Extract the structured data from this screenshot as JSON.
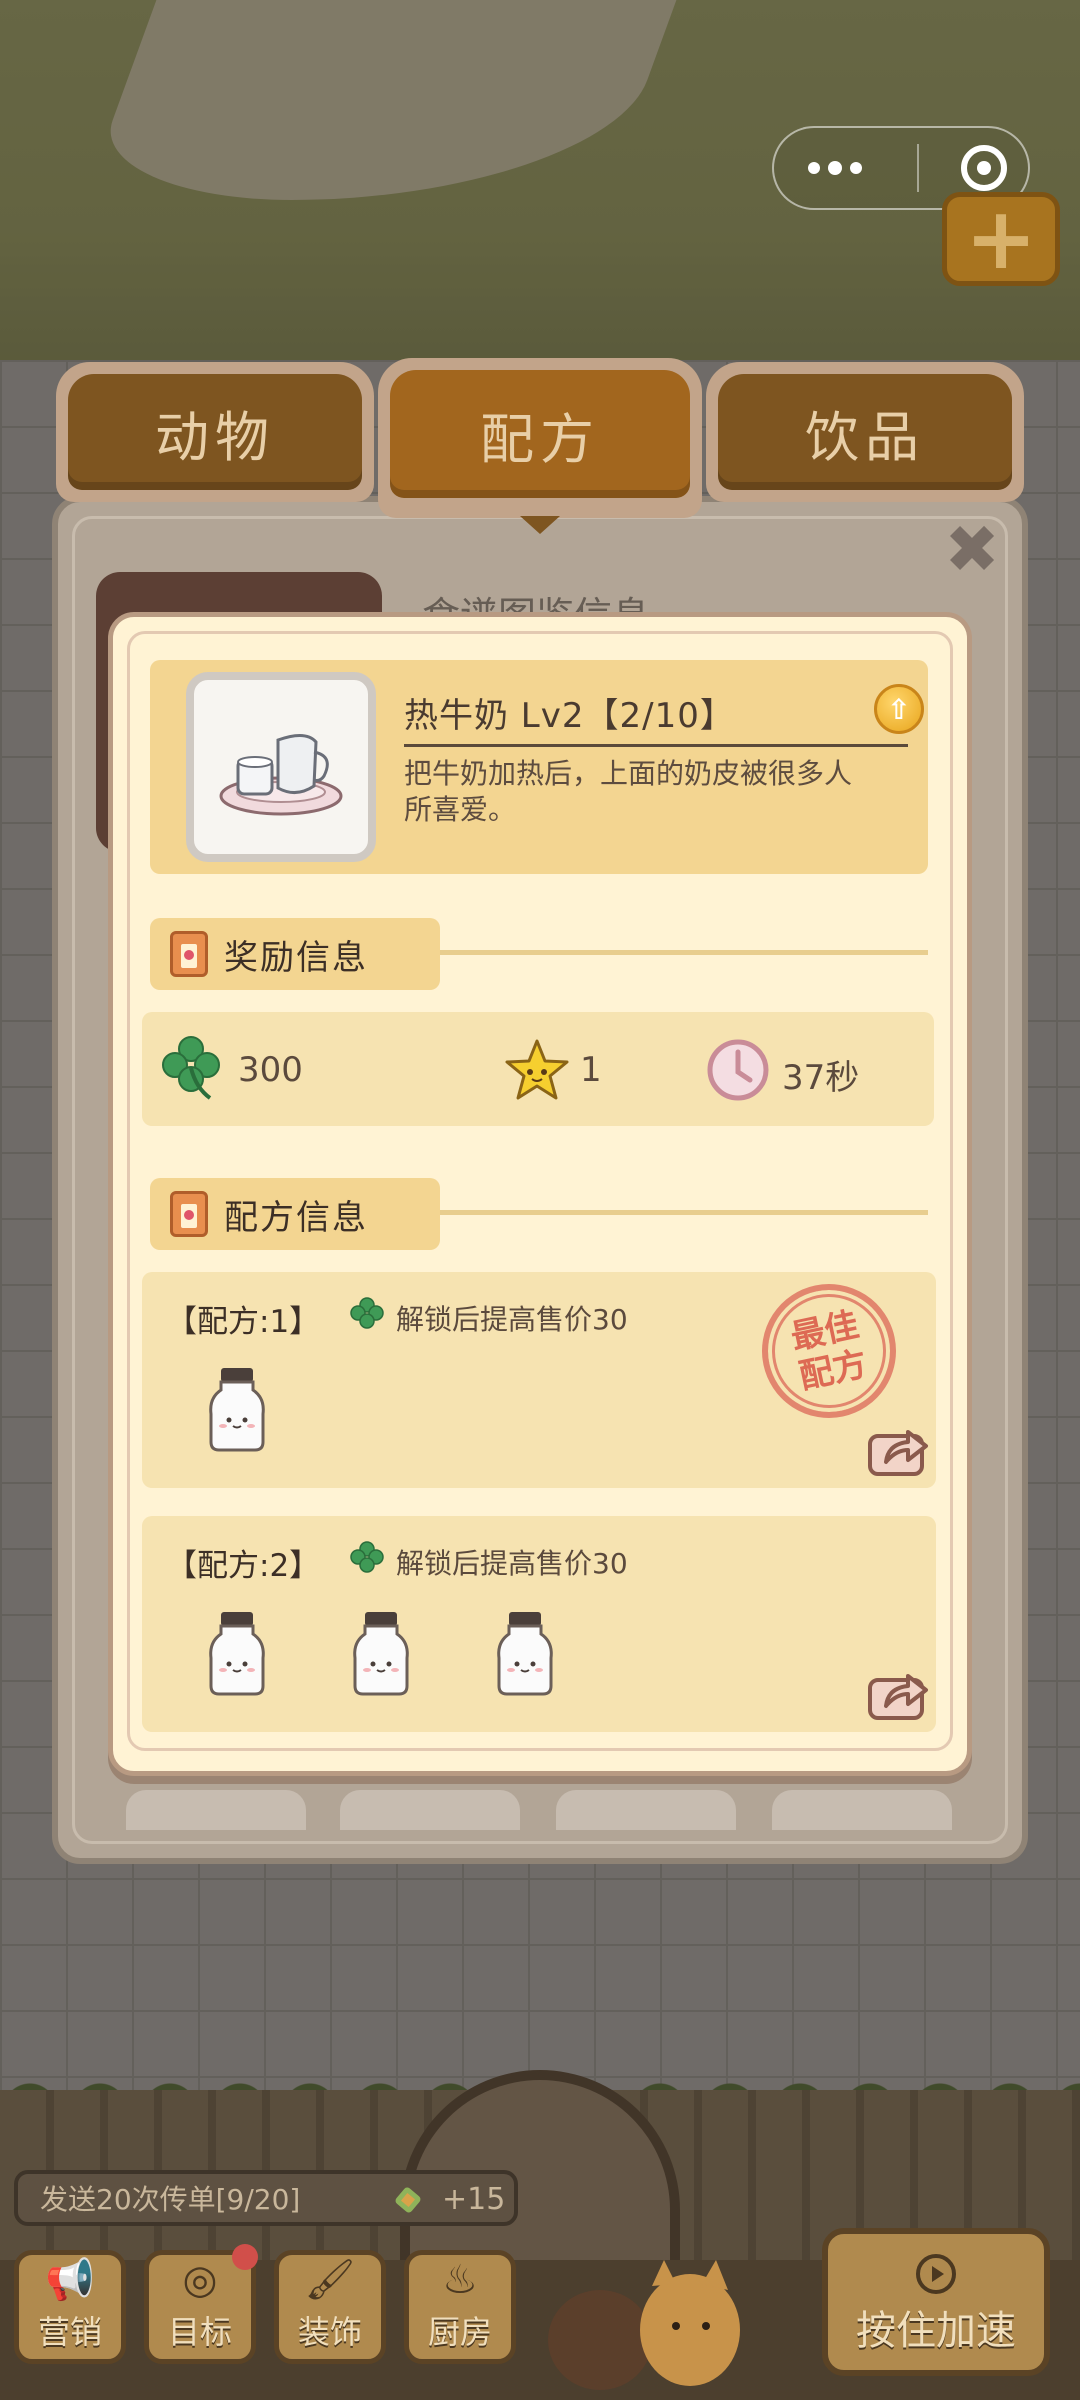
{
  "tabs": [
    {
      "label": "动物"
    },
    {
      "label": "配方"
    },
    {
      "label": "饮品"
    }
  ],
  "background": {
    "partial_heading": "食谱图鉴信息"
  },
  "item": {
    "name": "热牛奶 Lv2【2/10】",
    "description": "把牛奶加热后，上面的奶皮被很多人所喜爱。"
  },
  "rewards": {
    "section_title": "奖励信息",
    "clover": "300",
    "star": "1",
    "time": "37秒"
  },
  "recipes": {
    "section_title": "配方信息",
    "list": [
      {
        "label": "【配方:1】",
        "effect": "解锁后提高售价30",
        "ingredient_count": 1,
        "best": true
      },
      {
        "label": "【配方:2】",
        "effect": "解锁后提高售价30",
        "ingredient_count": 3,
        "best": false
      }
    ],
    "best_stamp": [
      "最佳",
      "配方"
    ]
  },
  "bottom": {
    "flyer": "发送20次传单[9/20]",
    "flyer_reward": "+15",
    "nav": [
      {
        "label": "营销",
        "icon": "megaphone-icon"
      },
      {
        "label": "目标",
        "icon": "target-icon"
      },
      {
        "label": "装饰",
        "icon": "paint-roller-icon"
      },
      {
        "label": "厨房",
        "icon": "cooking-pot-icon"
      }
    ],
    "speed_button": "按住加速"
  },
  "colors": {
    "dialog_bg": "#fff3d4",
    "section_bg": "#f3d591",
    "tab_brown": "#7e5520",
    "stamp_red": "#dd6a54"
  }
}
